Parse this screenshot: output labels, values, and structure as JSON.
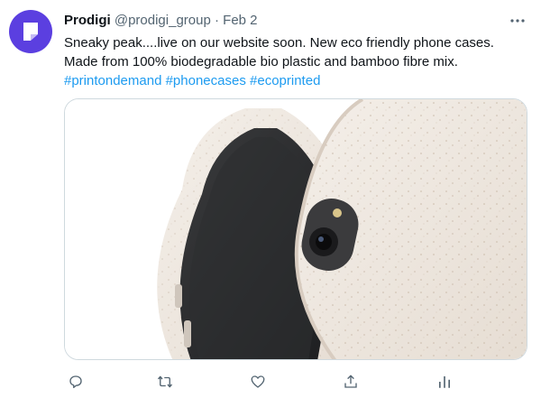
{
  "tweet": {
    "author": {
      "display_name": "Prodigi",
      "handle": "@prodigi_group",
      "separator": "·",
      "date": "Feb 2",
      "avatar_color": "#5b3fe0"
    },
    "text_lines": [
      "Sneaky peak....live on our website soon. New eco friendly phone cases.",
      "Made from 100% biodegradable bio plastic and bamboo fibre mix."
    ],
    "hashtags": [
      "#printondemand",
      "#phonecases",
      "#ecoprinted"
    ],
    "media": {
      "icon": "phone-case-photo"
    },
    "actions": {
      "reply_icon": "reply-icon",
      "retweet_icon": "retweet-icon",
      "like_icon": "like-icon",
      "share_icon": "share-icon",
      "analytics_icon": "analytics-icon"
    },
    "colors": {
      "link": "#1d9bf0",
      "secondary": "#536471",
      "border": "#cfd9de"
    }
  }
}
